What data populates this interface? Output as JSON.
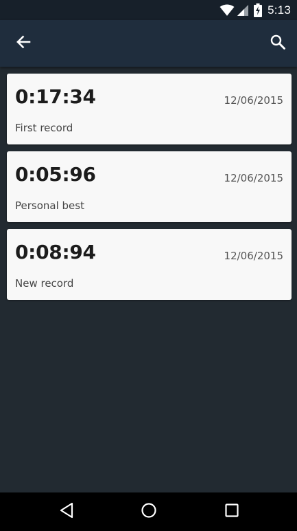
{
  "status_bar": {
    "time": "5:13",
    "icons": [
      "wifi-icon",
      "signal-icon",
      "battery-charging-icon"
    ]
  },
  "app_bar": {
    "back_icon": "arrow-left-icon",
    "search_icon": "search-icon"
  },
  "records": [
    {
      "time": "0:17:34",
      "date": "12/06/2015",
      "label": "First record"
    },
    {
      "time": "0:05:96",
      "date": "12/06/2015",
      "label": "Personal best"
    },
    {
      "time": "0:08:94",
      "date": "12/06/2015",
      "label": "New record"
    }
  ],
  "nav_bar": {
    "icons": [
      "nav-back-icon",
      "nav-home-icon",
      "nav-recents-icon"
    ]
  },
  "colors": {
    "status_bar": "#17202a",
    "app_bar": "#1f2d3d",
    "background": "#222a31",
    "card": "#f8f8f8"
  }
}
